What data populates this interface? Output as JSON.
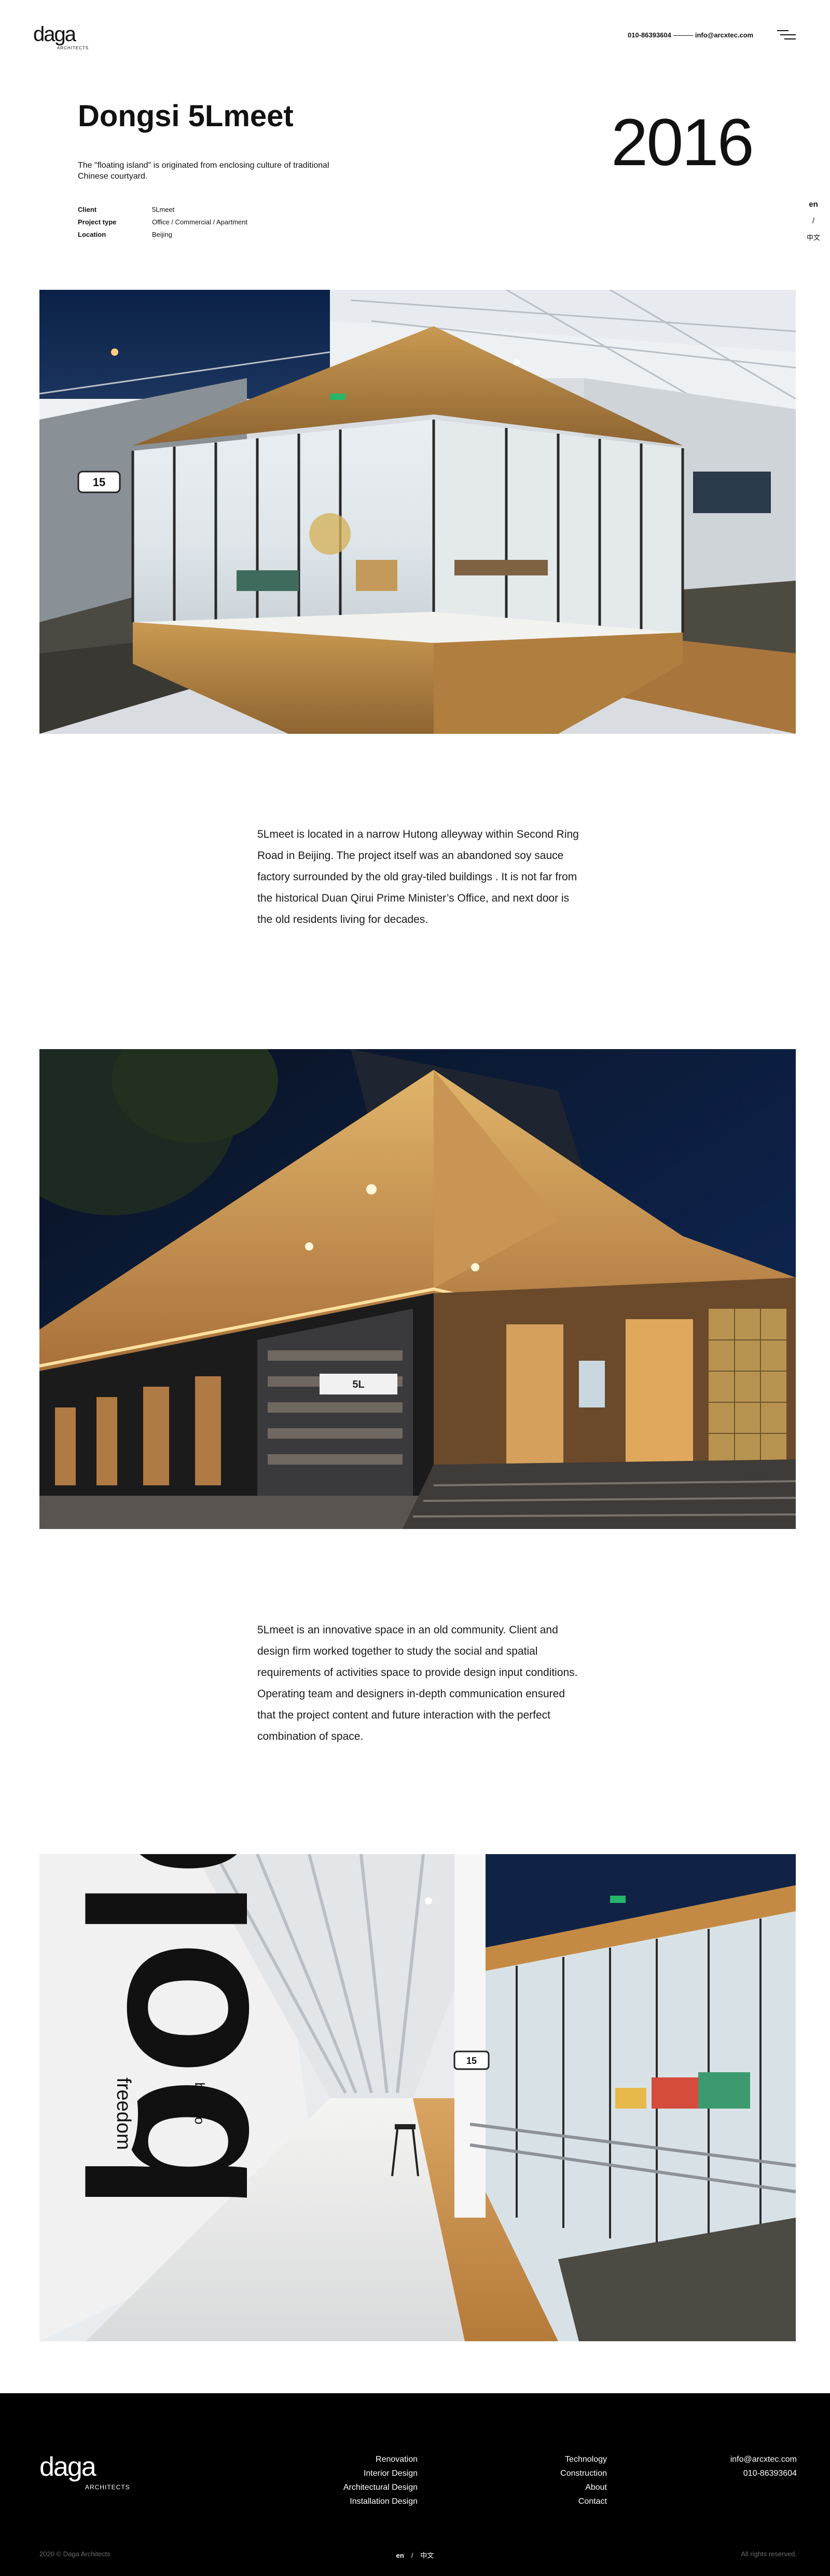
{
  "header": {
    "logo_text": "daga",
    "logo_sub": "ARCHITECTS",
    "phone": "010-86393604",
    "email": "info@arcxtec.com"
  },
  "project": {
    "title": "Dongsi 5Lmeet",
    "year": "2016",
    "description": "The \"floating island\" is originated from enclosing culture of traditional Chinese courtyard.",
    "meta": [
      {
        "label": "Client",
        "value": "5Lmeet"
      },
      {
        "label": "Project type",
        "value": "Office / Commercial / Apartment"
      },
      {
        "label": "Location",
        "value": "Beijing"
      }
    ]
  },
  "language_switch": {
    "en": "en",
    "sep": "/",
    "zh": "中文"
  },
  "photos": {
    "photo1_alt": "glass-box-interior",
    "photo2_alt": "exterior-night-canopy",
    "photo3_alt": "corridor-bold-wall",
    "photo3_wall_word": "bold",
    "photo3_wall_badge": "freedom",
    "photo3_wall_badge2": "born to"
  },
  "paragraphs": [
    "5Lmeet is located in a narrow Hutong alleyway within Second Ring Road in Beijing. The project itself was an abandoned soy sauce factory surrounded by the old gray-tiled buildings . It is not far from the historical Duan Qirui Prime Minister’s Office, and next door is the old residents living for decades.",
    "5Lmeet is an innovative space in an old community. Client and design firm worked together to study the social and spatial requirements of activities space to provide design input conditions. Operating team and designers in-depth communication ensured that the project content and future interaction with the perfect combination of space."
  ],
  "footer": {
    "logo_text": "daga",
    "logo_sub": "ARCHITECTS",
    "col1": [
      "Renovation",
      "Interior Design",
      "Architectural Design",
      "Installation Design"
    ],
    "col2": [
      "Technology",
      "Construction",
      "About",
      "Contact"
    ],
    "email": "info@arcxtec.com",
    "phone": "010-86393604",
    "copyright": "2020 © Daga Architects",
    "lang_en": "en",
    "lang_sep": "/",
    "lang_zh": "中文",
    "rights": "All rights reserved."
  },
  "colors": {
    "accent_wood": "#c9924a",
    "night_sky": "#0d1a33",
    "footer_bg": "#000000"
  }
}
